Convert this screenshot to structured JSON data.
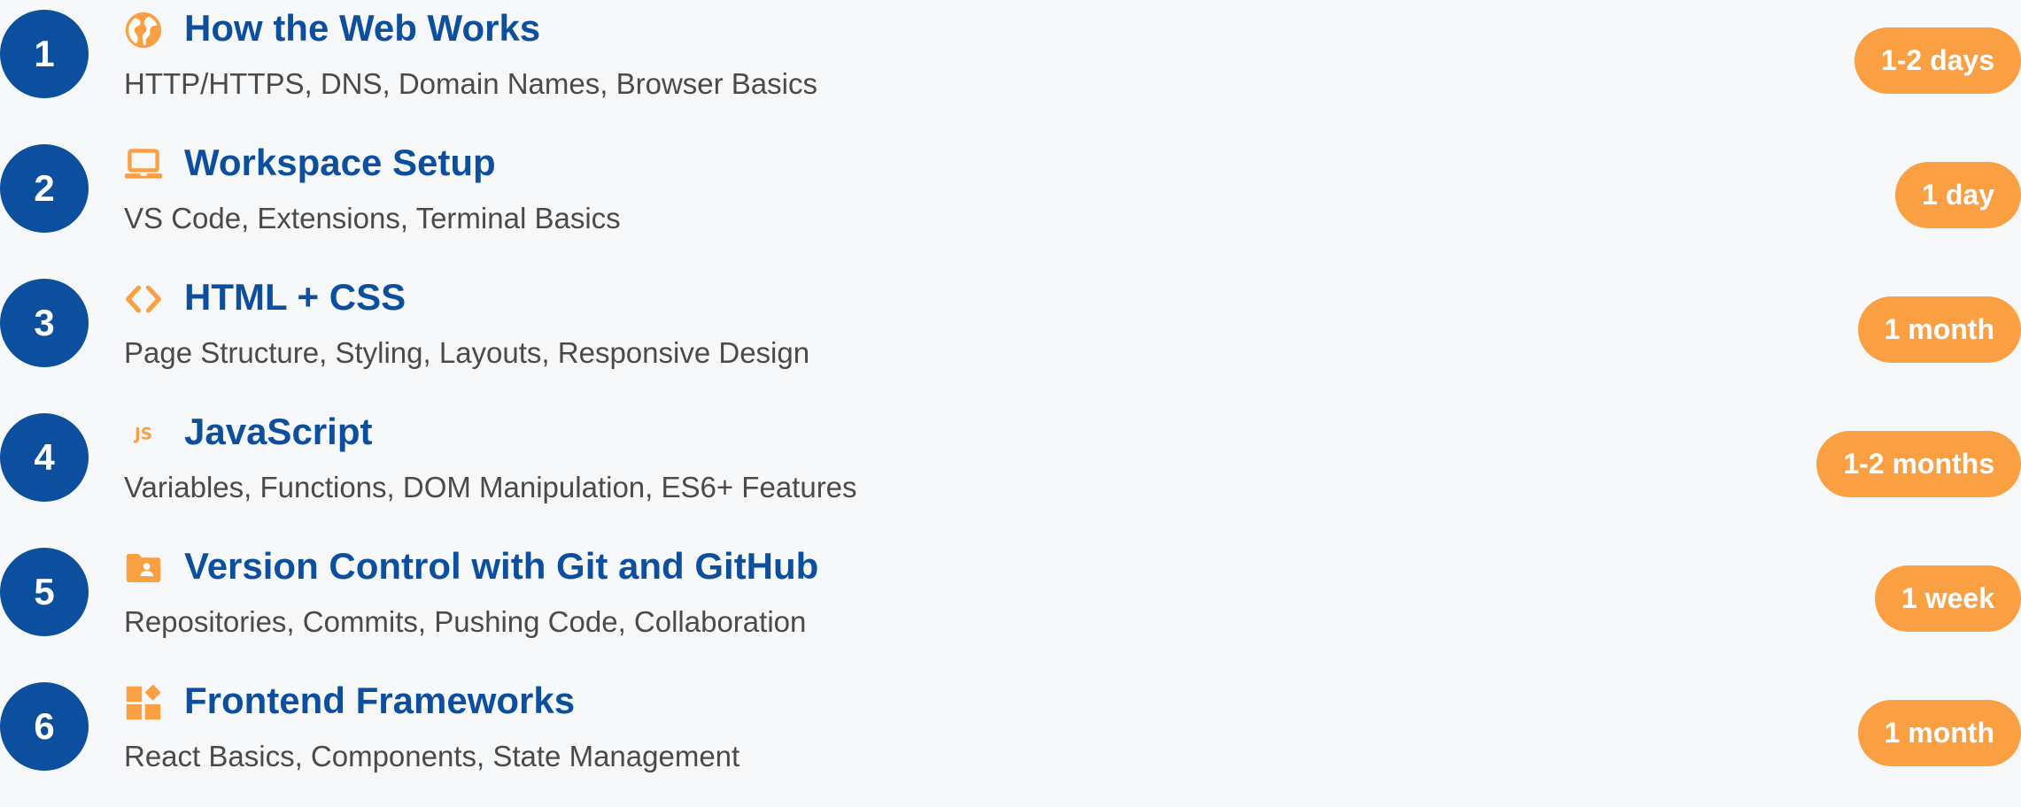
{
  "steps": [
    {
      "number": "1",
      "icon": "globe-icon",
      "title": "How the Web Works",
      "topics": "HTTP/HTTPS, DNS, Domain Names, Browser Basics",
      "duration": "1-2 days"
    },
    {
      "number": "2",
      "icon": "laptop-icon",
      "title": "Workspace Setup",
      "topics": "VS Code, Extensions, Terminal Basics",
      "duration": "1 day"
    },
    {
      "number": "3",
      "icon": "code-brackets-icon",
      "title": "HTML + CSS",
      "topics": "Page Structure, Styling, Layouts, Responsive Design",
      "duration": "1 month"
    },
    {
      "number": "4",
      "icon": "javascript-icon",
      "icon_text": "JS",
      "title": "JavaScript",
      "topics": "Variables, Functions, DOM Manipulation, ES6+ Features",
      "duration": "1-2 months"
    },
    {
      "number": "5",
      "icon": "folder-user-icon",
      "title": "Version Control with Git and GitHub",
      "topics": "Repositories, Commits, Pushing Code, Collaboration",
      "duration": "1 week"
    },
    {
      "number": "6",
      "icon": "widgets-icon",
      "title": "Frontend Frameworks",
      "topics": "React Basics, Components, State Management",
      "duration": "1 month"
    }
  ],
  "colors": {
    "step_circle": "#0b4f9e",
    "title": "#0b4f9e",
    "topics": "#4a4a4a",
    "accent": "#fb9f43",
    "background": "#f7f8fa"
  }
}
